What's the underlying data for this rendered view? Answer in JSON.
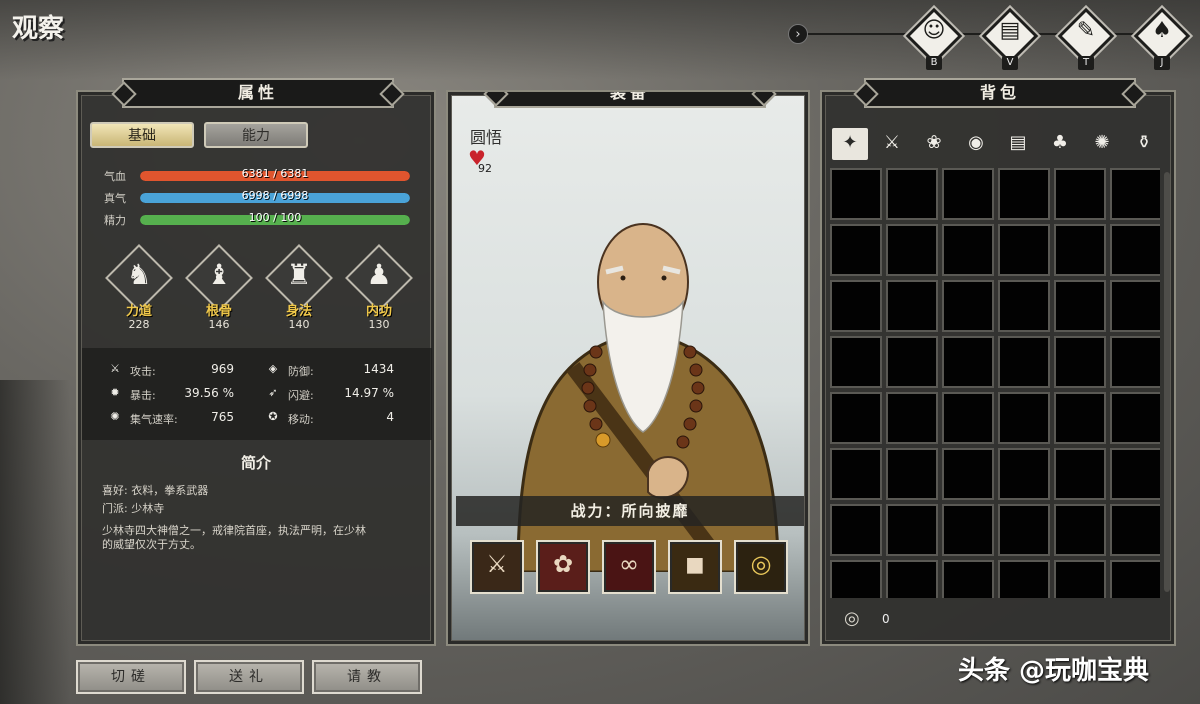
{
  "screen_title": "观察",
  "nav": {
    "buttons": [
      {
        "key": "B",
        "icon": "character-bag-icon"
      },
      {
        "key": "V",
        "icon": "book-icon"
      },
      {
        "key": "T",
        "icon": "skill-scroll-icon"
      },
      {
        "key": "J",
        "icon": "meditation-icon"
      }
    ]
  },
  "attributes": {
    "header": "属性",
    "tabs": {
      "basic": "基础",
      "ability": "能力"
    },
    "bars": [
      {
        "label": "气血",
        "text": "6381 / 6381",
        "fraction": 1.0,
        "color": "#e0552e"
      },
      {
        "label": "真气",
        "text": "6998 / 6998",
        "fraction": 1.0,
        "color": "#4aa3d8"
      },
      {
        "label": "精力",
        "text": "100 / 100",
        "fraction": 1.0,
        "color": "#56b04e"
      }
    ],
    "stats": [
      {
        "name": "力道",
        "value": "228"
      },
      {
        "name": "根骨",
        "value": "146"
      },
      {
        "name": "身法",
        "value": "140"
      },
      {
        "name": "内功",
        "value": "130"
      }
    ],
    "combat": [
      {
        "label": "攻击:",
        "value": "969"
      },
      {
        "label": "防御:",
        "value": "1434"
      },
      {
        "label": "暴击:",
        "value": "39.56 %"
      },
      {
        "label": "闪避:",
        "value": "14.97 %"
      },
      {
        "label": "集气速率:",
        "value": "765"
      },
      {
        "label": "移动:",
        "value": "4"
      }
    ],
    "intro": {
      "title": "简介",
      "hobby": "喜好: 衣料，拳系武器",
      "faction": "门派: 少林寺",
      "desc_line1": "少林寺四大神僧之一，戒律院首座，执法严明，在少林",
      "desc_line2": "的威望仅次于方丈。"
    }
  },
  "actions": {
    "spar": "切磋",
    "gift": "送礼",
    "consult": "请教"
  },
  "equipment": {
    "header": "装备",
    "character_name": "圆悟",
    "favor": "92",
    "combat_power": "战力：所向披靡",
    "slots": [
      {
        "icon": "claw-gauntlet-icon",
        "glyph": "⚔",
        "bg": "#3a2818"
      },
      {
        "icon": "robe-armor-icon",
        "glyph": "✿",
        "bg": "#5a1e1a"
      },
      {
        "icon": "prayer-beads-icon",
        "glyph": "∞",
        "bg": "#4a1414"
      },
      {
        "icon": "boots-icon",
        "glyph": "◼",
        "bg": "#3a2a12"
      },
      {
        "icon": "ring-icon",
        "glyph": "◎",
        "bg": "#2c2210"
      }
    ]
  },
  "bag": {
    "header": "背包",
    "tabs": [
      {
        "icon": "all-items-icon",
        "glyph": "✦"
      },
      {
        "icon": "weapon-icon",
        "glyph": "⚔"
      },
      {
        "icon": "armor-icon",
        "glyph": "❀"
      },
      {
        "icon": "accessory-icon",
        "glyph": "◉"
      },
      {
        "icon": "book-icon",
        "glyph": "▤"
      },
      {
        "icon": "herb-icon",
        "glyph": "♣"
      },
      {
        "icon": "material-icon",
        "glyph": "✺"
      },
      {
        "icon": "misc-icon",
        "glyph": "⚱"
      }
    ],
    "coins": "0"
  },
  "watermark": "头条 @玩咖宝典"
}
